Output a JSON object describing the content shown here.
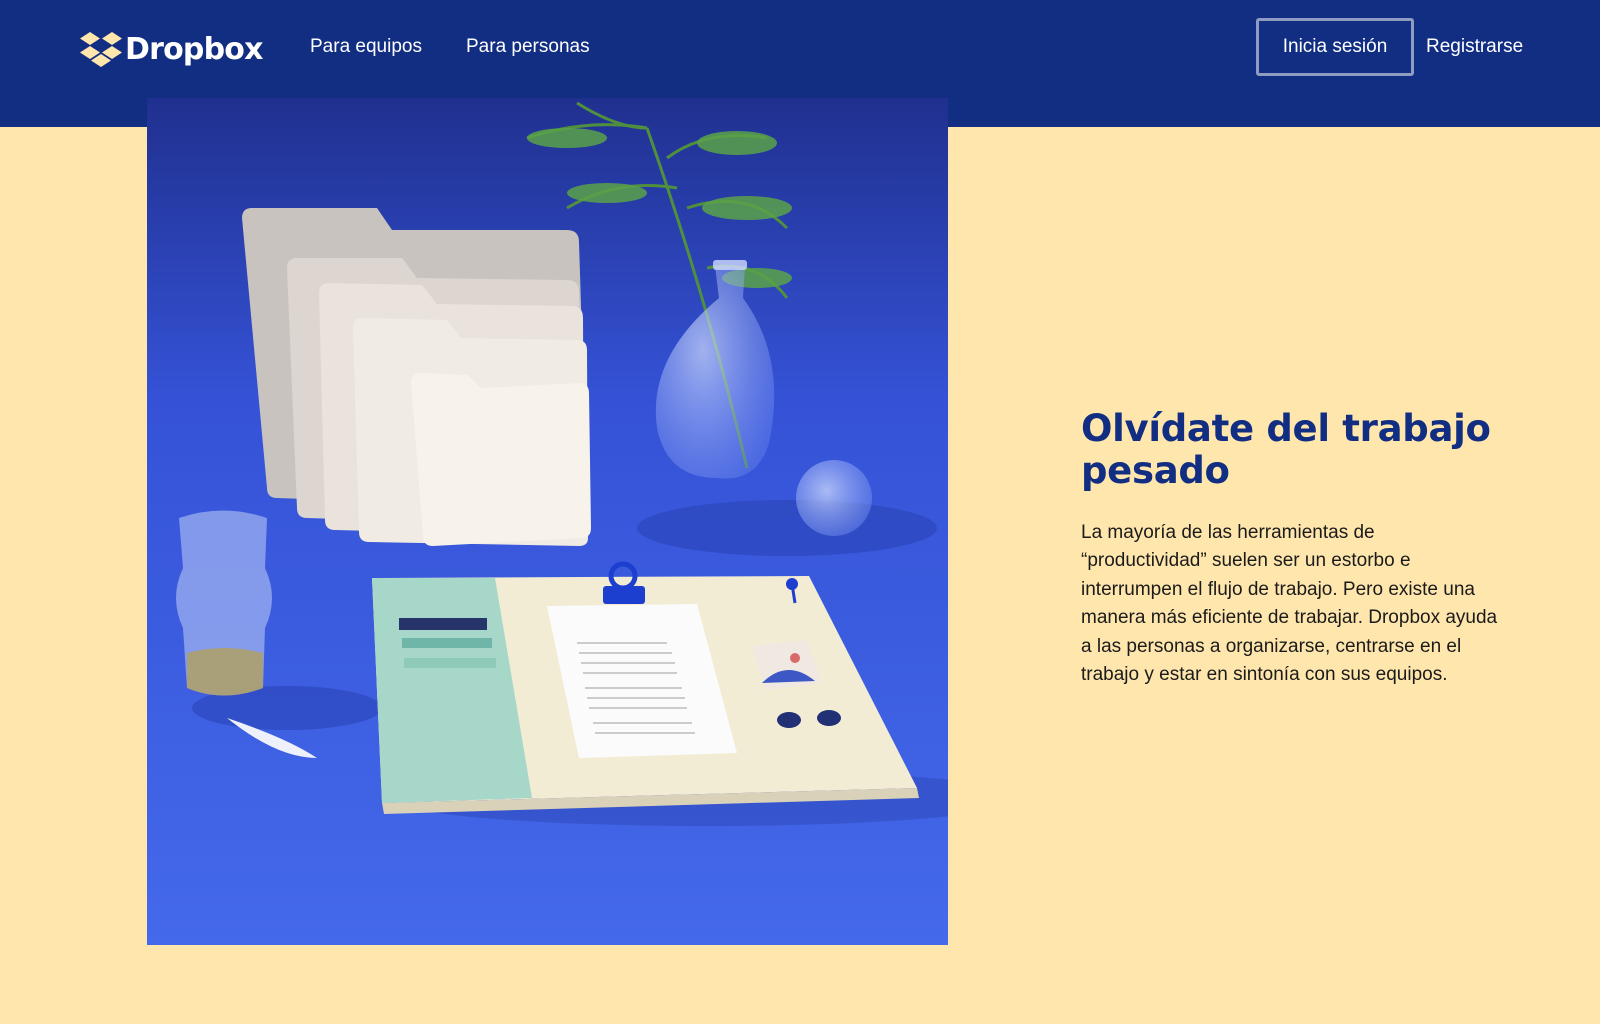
{
  "header": {
    "logo_text": "Dropbox",
    "logo_icon": "dropbox-box-icon",
    "nav_links": [
      "Para equipos",
      "Para personas"
    ],
    "login_button": "Inicia sesión",
    "register_link": "Registrarse"
  },
  "hero": {
    "image_alt": "hero-photo",
    "headline": "Olvídate del trabajo pesado",
    "body": "La mayoría de las herramientas de “productividad” suelen ser un estorbo e interrumpen el flujo de trabajo. Pero existe una manera más eficiente de trabajar. Dropbox ayuda a las personas a organizarse, centrarse en el trabajo y estar en sintonía con sus equipos."
  },
  "colors": {
    "header_bg": "#112e83",
    "page_bg": "#ffe6ad",
    "accent": "#112e83",
    "photo_bg": "#3a5be0"
  }
}
